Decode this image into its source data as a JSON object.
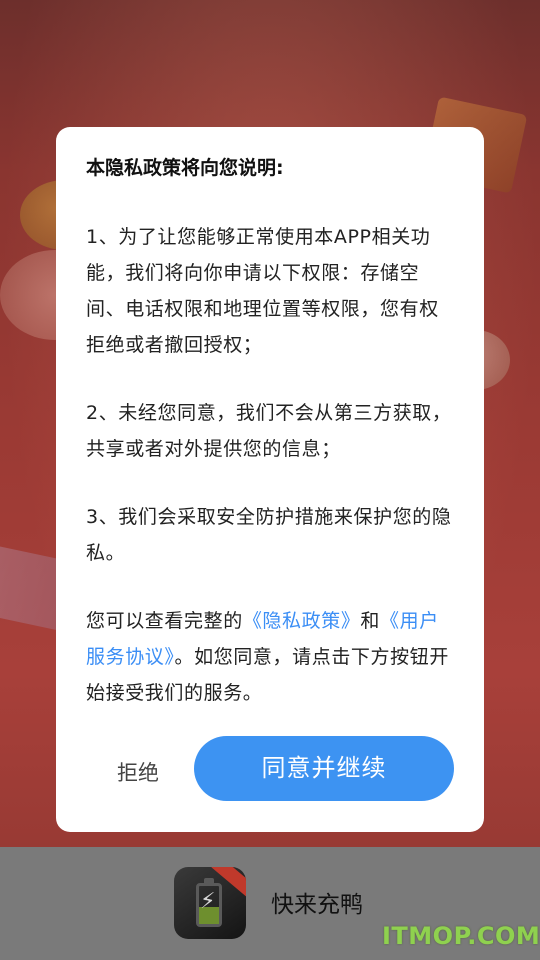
{
  "dialog": {
    "title": "本隐私政策将向您说明:",
    "paragraphs": [
      "1、为了让您能够正常使用本APP相关功能，我们将向你申请以下权限：存储空间、电话权限和地理位置等权限，您有权拒绝或者撤回授权；",
      "2、未经您同意，我们不会从第三方获取，共享或者对外提供您的信息；",
      "3、我们会采取安全防护措施来保护您的隐私。"
    ],
    "notice": {
      "prefix": "您可以查看完整的",
      "privacy_link": "《隐私政策》",
      "middle": "和",
      "terms_link": "《用户服务协议》",
      "suffix": "。如您同意，请点击下方按钮开始接受我们的服务。"
    },
    "reject_label": "拒绝",
    "agree_label": "同意并继续"
  },
  "splash": {
    "app_name": "快来充鸭",
    "app_icon": "battery-charging-icon"
  },
  "watermark": "ITMOP.COM",
  "colors": {
    "accent": "#3d93f2",
    "link": "#3b8ef5",
    "background": "#9b3a34",
    "watermark": "#8fd14f"
  }
}
